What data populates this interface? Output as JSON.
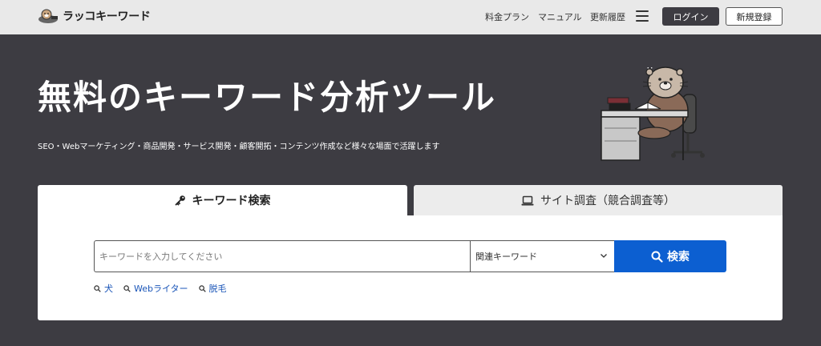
{
  "header": {
    "logo_text": "ラッコキーワード",
    "nav": {
      "price": "料金プラン",
      "manual": "マニュアル",
      "history": "更新履歴"
    },
    "login_label": "ログイン",
    "signup_label": "新規登録"
  },
  "hero": {
    "title": "無料のキーワード分析ツール",
    "subtitle": "SEO・Webマーケティング・商品開発・サービス開発・顧客開拓・コンテンツ作成など様々な場面で活躍します"
  },
  "tabs": [
    {
      "label": "キーワード検索",
      "icon": "key-icon",
      "active": true
    },
    {
      "label": "サイト調査（競合調査等）",
      "icon": "laptop-icon",
      "active": false
    }
  ],
  "search": {
    "placeholder": "キーワードを入力してください",
    "value": "",
    "select_value": "関連キーワード",
    "button_label": "検索"
  },
  "suggestions": [
    "犬",
    "Webライター",
    "脱毛"
  ],
  "colors": {
    "hero_bg": "#3d3c42",
    "accent_blue": "#0c5fd1",
    "link_blue": "#1a55b8"
  }
}
